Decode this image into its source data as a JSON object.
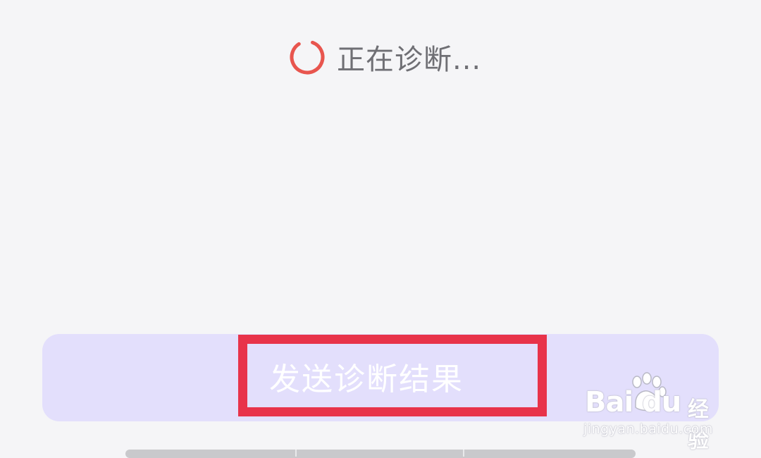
{
  "status": {
    "text": "正在诊断...",
    "spinner_icon": "loading-spinner-icon",
    "spinner_color": "#e8554e"
  },
  "send_button": {
    "label": "发送诊断结果",
    "background": "#e3dffc"
  },
  "annotation": {
    "color": "#e8334a"
  },
  "watermark": {
    "brand": "Bai du",
    "brand_suffix": "经验",
    "url": "jingyan.baidu.com"
  }
}
